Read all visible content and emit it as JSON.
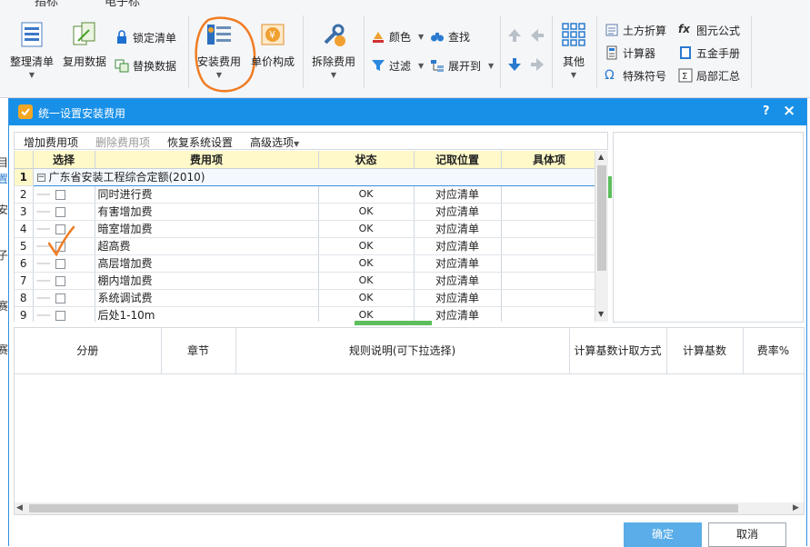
{
  "tabs": [
    "指标",
    "电子标"
  ],
  "ribbon": {
    "organize": "整理清单",
    "reuse": "复用数据",
    "lock": "锁定清单",
    "replace": "替换数据",
    "install_fee": "安装费用",
    "unit_price": "单价构成",
    "split_fee": "拆除费用",
    "color": "颜色",
    "find": "查找",
    "filter": "过滤",
    "expand": "展开到",
    "other": "其他",
    "earth": "土方折算",
    "element_formula": "图元公式",
    "calculator": "计算器",
    "hardware": "五金手册",
    "special_symbol": "特殊符号",
    "partial_sum": "局部汇总"
  },
  "dialog": {
    "title": "统一设置安装费用",
    "help": "?",
    "close": "×",
    "toolbar": {
      "add": "增加费用项",
      "delete": "删除费用项",
      "restore": "恢复系统设置",
      "advanced": "高级选项"
    },
    "columns": [
      "选择",
      "费用项",
      "状态",
      "记取位置",
      "具体项"
    ],
    "group": {
      "num": "1",
      "label": "广东省安装工程综合定额(2010)"
    },
    "rows": [
      {
        "num": "2",
        "name": "同时进行费",
        "status": "OK",
        "pos": "对应清单"
      },
      {
        "num": "3",
        "name": "有害增加费",
        "status": "OK",
        "pos": "对应清单"
      },
      {
        "num": "4",
        "name": "暗室增加费",
        "status": "OK",
        "pos": "对应清单"
      },
      {
        "num": "5",
        "name": "超高费",
        "status": "OK",
        "pos": "对应清单"
      },
      {
        "num": "6",
        "name": "高层增加费",
        "status": "OK",
        "pos": "对应清单"
      },
      {
        "num": "7",
        "name": "棚内增加费",
        "status": "OK",
        "pos": "对应清单"
      },
      {
        "num": "8",
        "name": "系统调试费",
        "status": "OK",
        "pos": "对应清单"
      },
      {
        "num": "9",
        "name": "后处1-10m",
        "status": "OK",
        "pos": "对应清单"
      }
    ],
    "bottom_columns": [
      "分册",
      "章节",
      "规则说明(可下拉选择)",
      "计算基数计取方式",
      "计算基数",
      "费率%"
    ],
    "ok": "确定",
    "cancel": "取消"
  },
  "left_strip": [
    "目",
    "置",
    "安",
    "子",
    "赛",
    "赛"
  ],
  "colors": {
    "accent": "#1890e8",
    "header": "#fff8c8",
    "annotation": "#f07c22"
  }
}
